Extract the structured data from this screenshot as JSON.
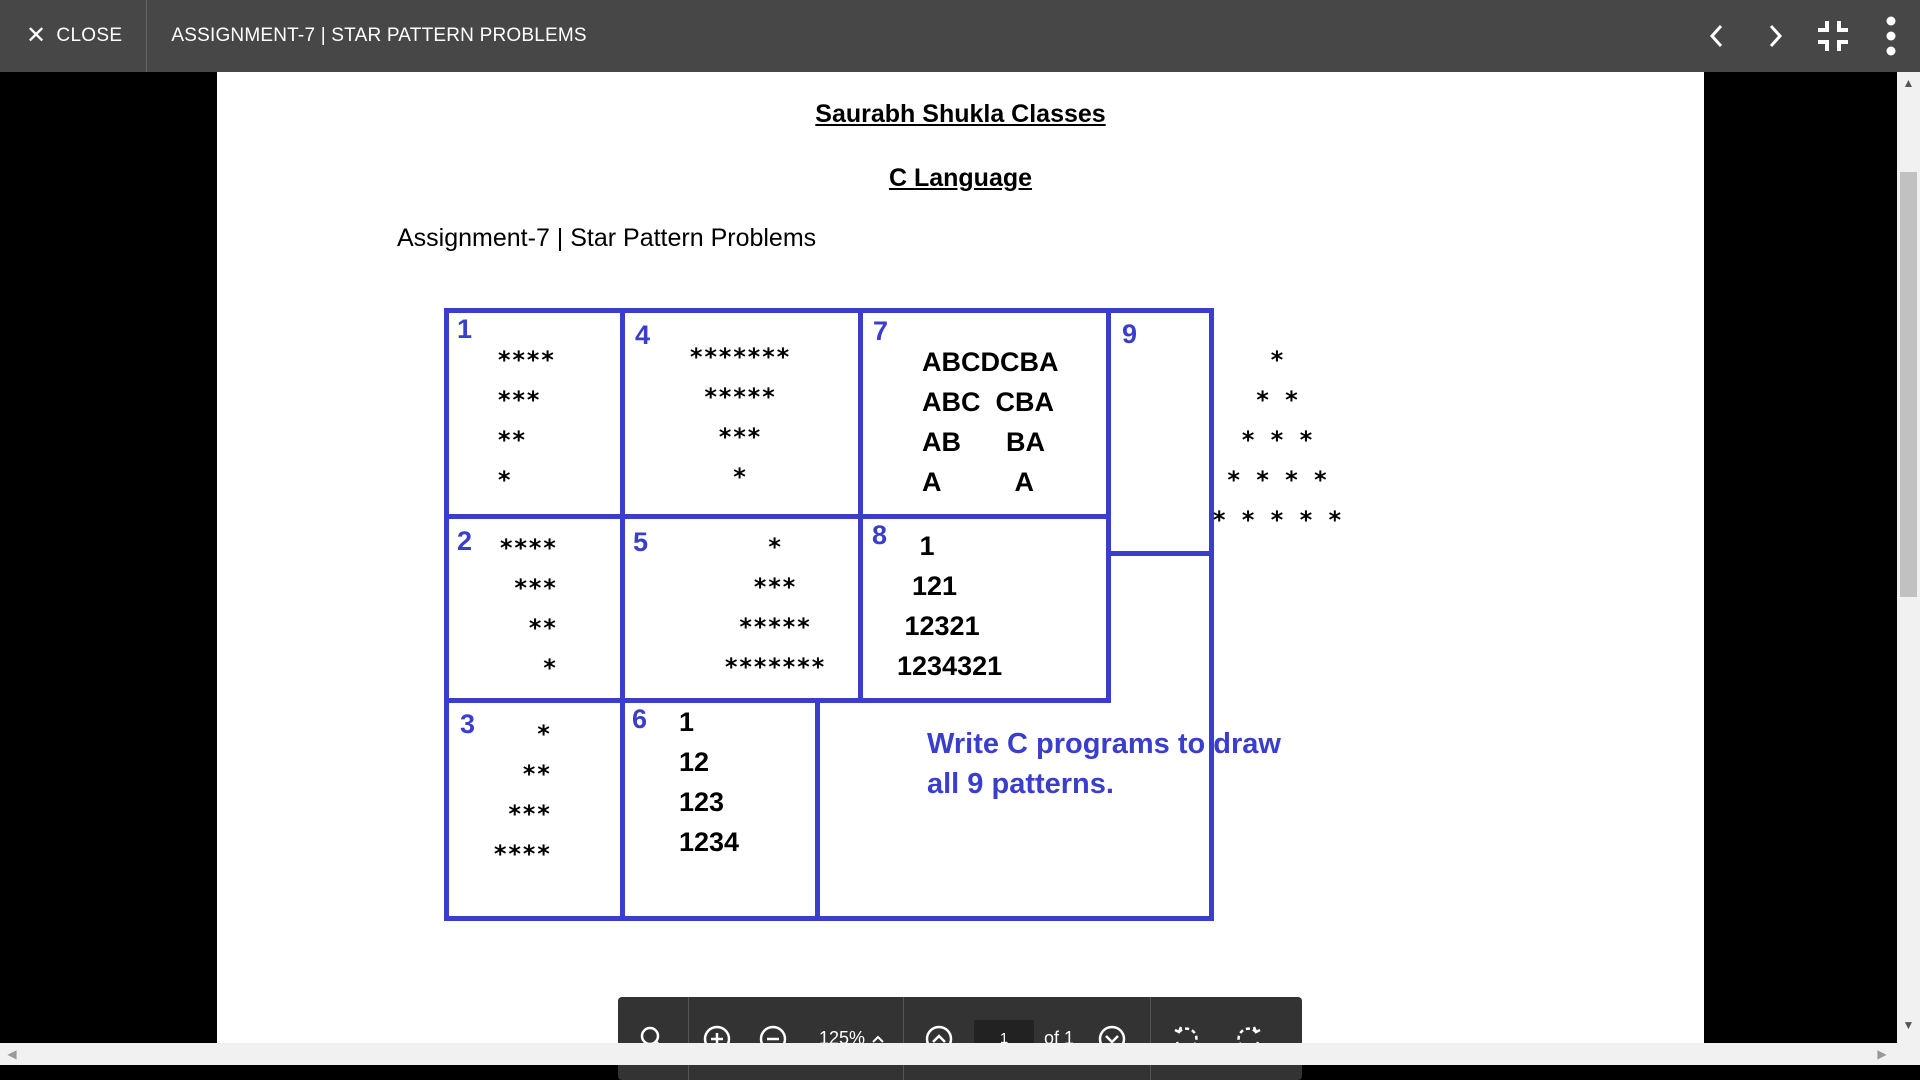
{
  "topbar": {
    "close_label": "CLOSE",
    "title": "ASSIGNMENT-7 | STAR PATTERN PROBLEMS"
  },
  "document": {
    "heading1": "Saurabh Shukla Classes",
    "heading2": "C Language",
    "subheading": "Assignment-7 | Star Pattern Problems",
    "patterns": [
      {
        "num": "1",
        "lines": "****\n***\n**\n*"
      },
      {
        "num": "2",
        "lines": "****\n ***\n  **\n   *"
      },
      {
        "num": "3",
        "lines": "   *\n  **\n ***\n****"
      },
      {
        "num": "4",
        "lines": "*******\n *****\n  ***\n   *"
      },
      {
        "num": "5",
        "lines": "   *\n  ***\n *****\n*******"
      },
      {
        "num": "6",
        "lines": "1\n12\n123\n1234"
      },
      {
        "num": "7",
        "lines": "ABCDCBA\nABC  CBA\nAB      BA\nA          A"
      },
      {
        "num": "8",
        "lines": "   1\n  121\n 12321\n1234321"
      },
      {
        "num": "9",
        "lines": "    *\n   * *\n  * * *\n * * * *\n* * * * *"
      }
    ],
    "instruction": "Write C programs to draw\nall 9 patterns."
  },
  "toolbar": {
    "zoom": "125%",
    "page_value": "1",
    "of_label": "of 1"
  },
  "colors": {
    "accent_blue": "#3a3ecc",
    "topbar": "#474747",
    "toolbar": "#333333"
  }
}
